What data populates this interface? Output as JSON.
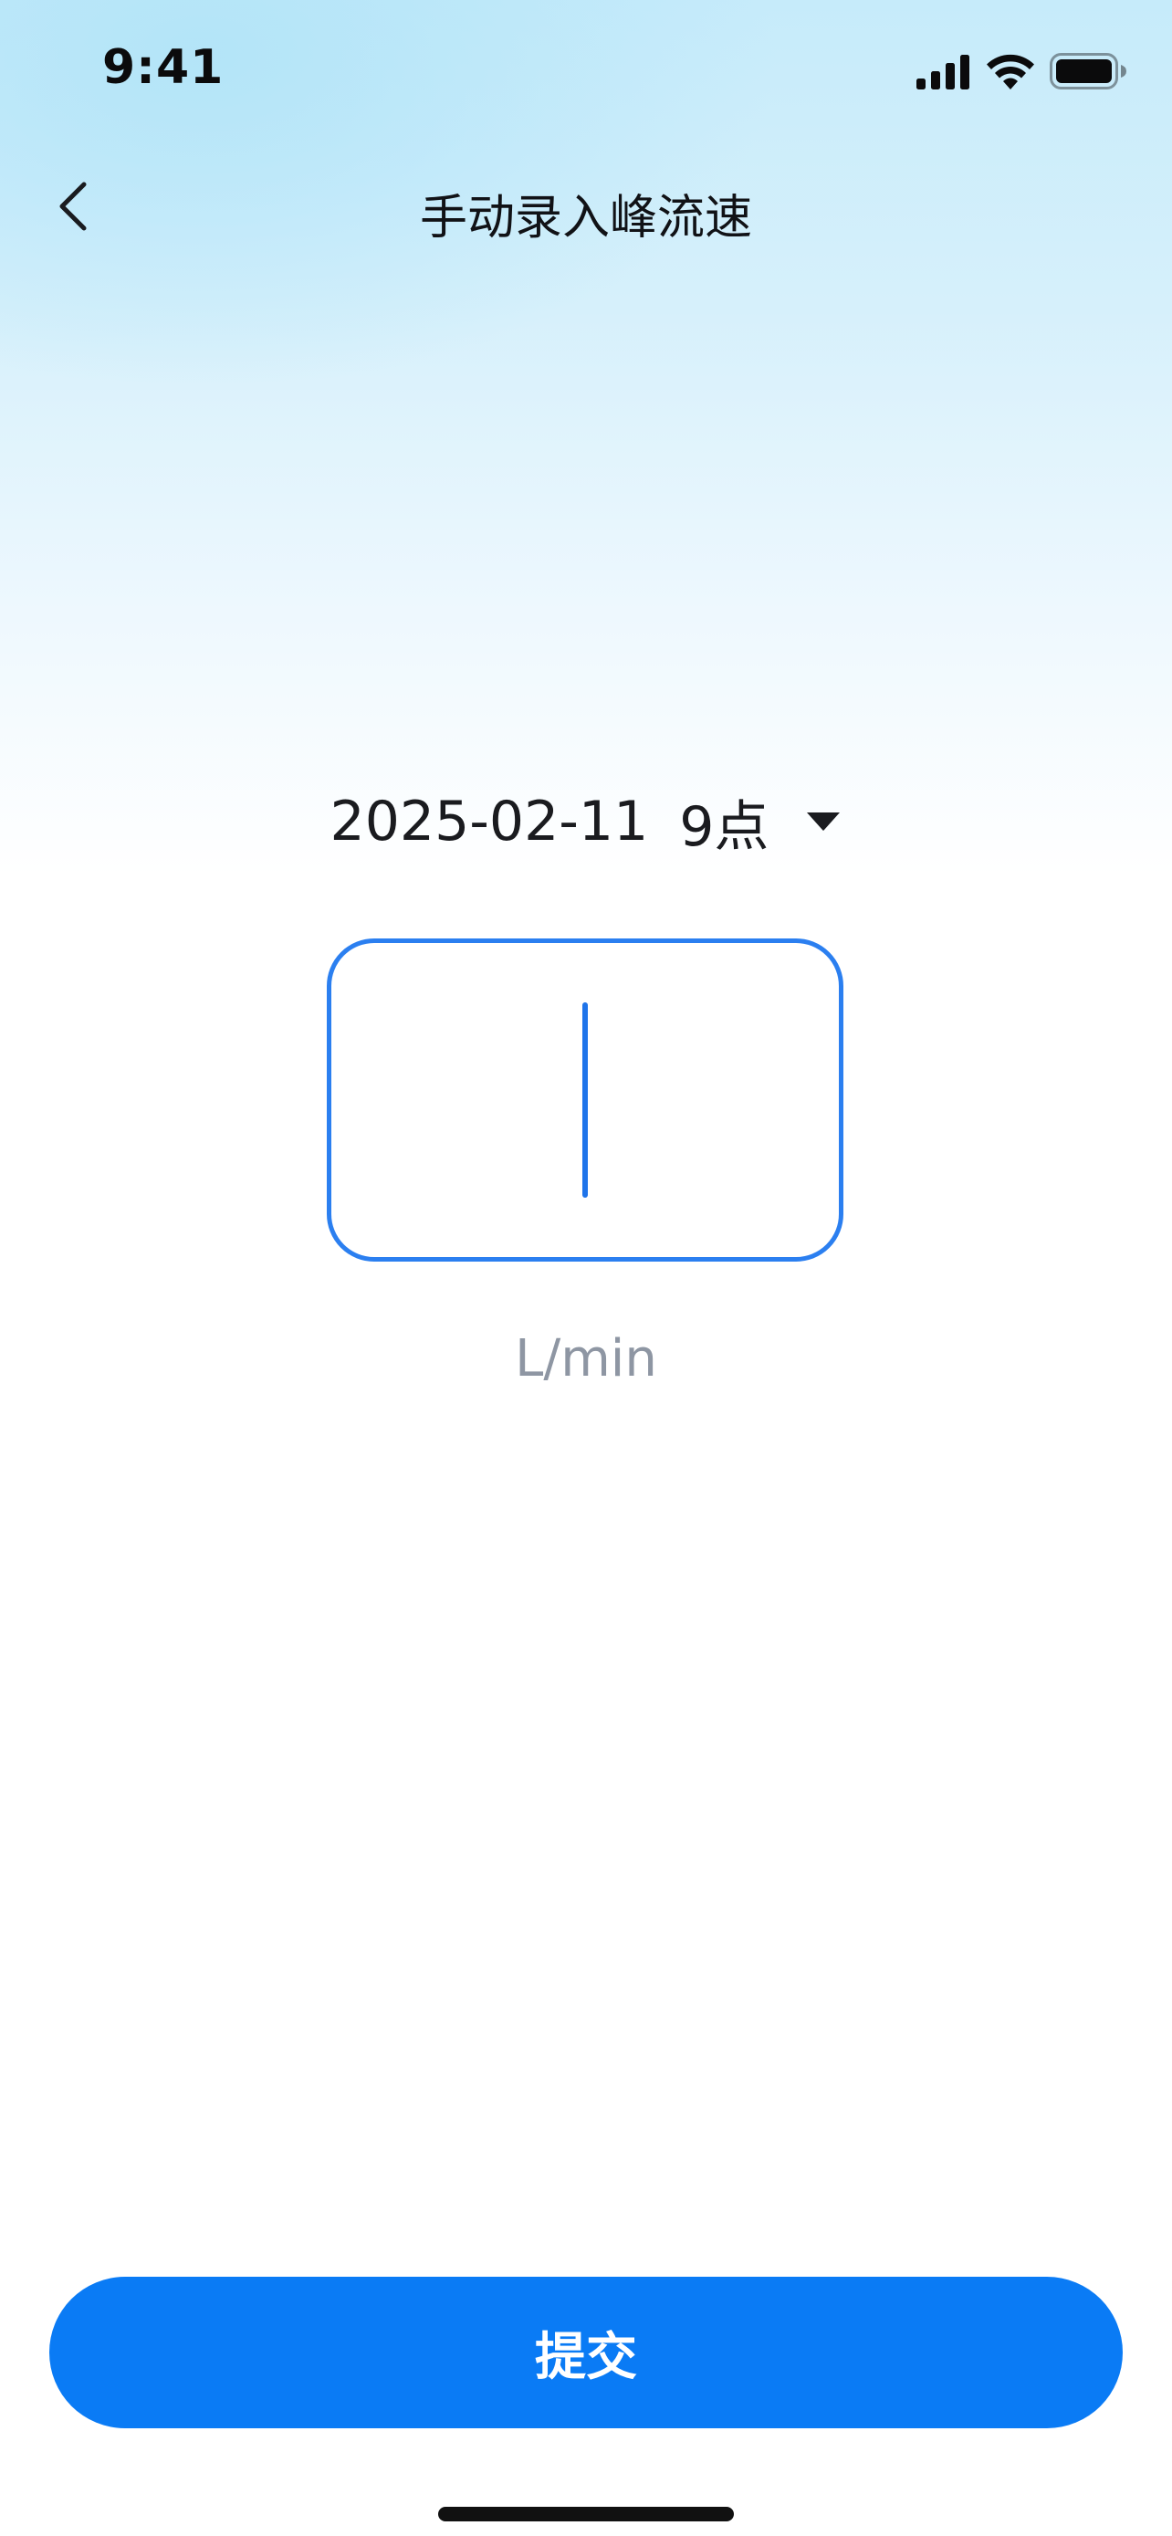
{
  "status_bar": {
    "time": "9:41",
    "icons": [
      "signal-icon",
      "wifi-icon",
      "battery-icon"
    ]
  },
  "nav": {
    "back_icon": "chevron-left-icon",
    "title": "手动录入峰流速"
  },
  "record": {
    "date": "2025-02-11",
    "hour": "9点",
    "dropdown_icon": "caret-down-icon"
  },
  "peak_flow_input": {
    "value": "",
    "unit": "L/min"
  },
  "submit": {
    "label": "提交"
  },
  "colors": {
    "accent": "#0a7bf5",
    "input_border": "#2b7ff0",
    "unit_text": "#8e96a3",
    "gradient_top": "#c6ebfa"
  }
}
